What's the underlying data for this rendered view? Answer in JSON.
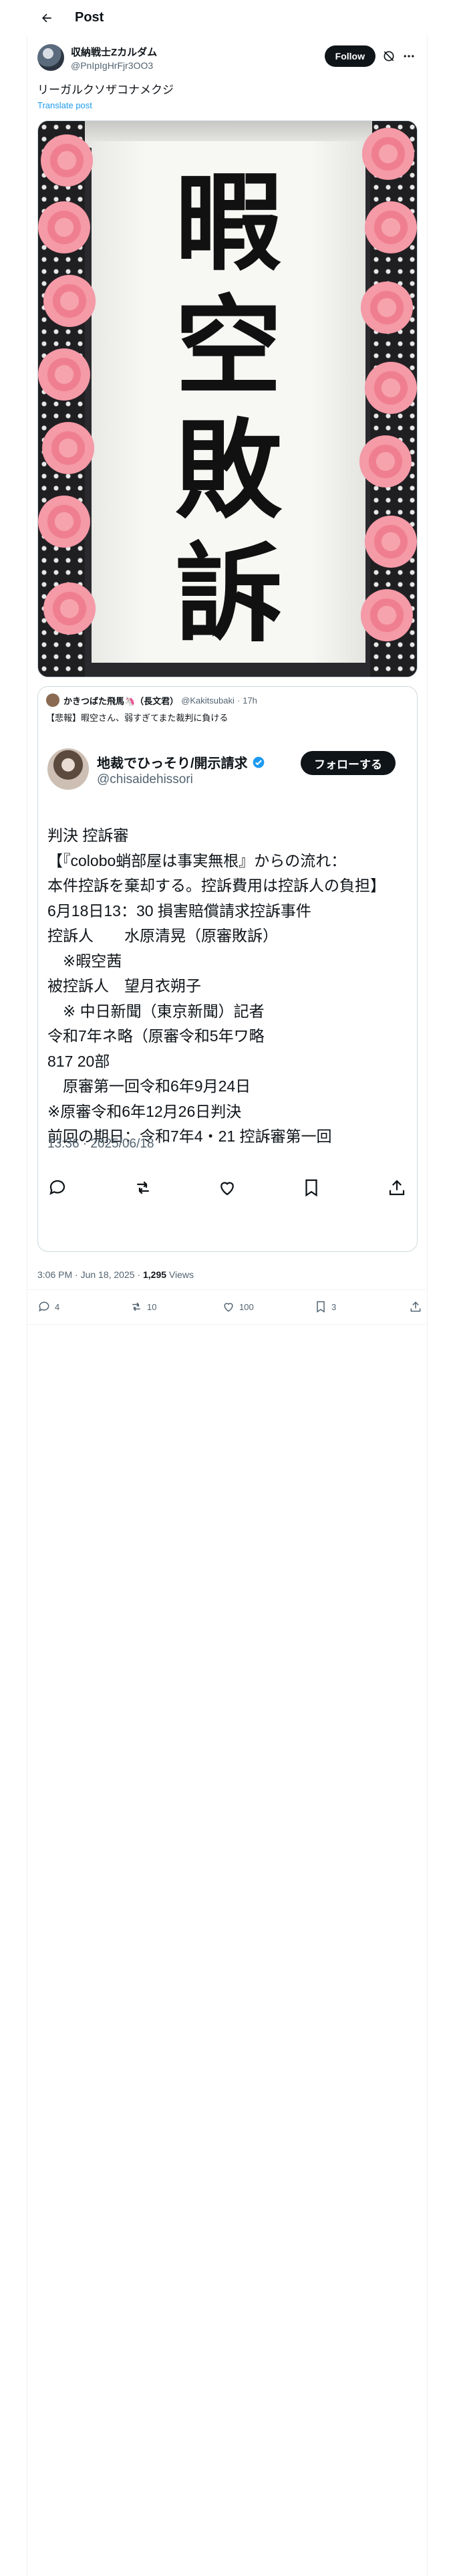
{
  "header": {
    "title": "Post"
  },
  "author": {
    "display_name": "収納戦士Zカルダム",
    "handle": "@PnIpIgHrFjr3OO3",
    "follow_label": "Follow"
  },
  "tweet": {
    "text": "リーガルクソザコナメクジ",
    "translate_label": "Translate post"
  },
  "media": {
    "calligraphy": [
      "暇",
      "空",
      "敗",
      "訴"
    ]
  },
  "quote": {
    "name": "かきつばた飛馬🦄（長文君）",
    "handle": "@Kakitsubaki",
    "time": "17h",
    "text": "【悲報】暇空さん、弱すぎてまた裁判に負ける",
    "inner": {
      "name": "地裁でひっそり/開示請求",
      "handle": "@chisaidehissori",
      "follow_label": "フォローする",
      "body": "判決 控訴審\n【『colobo蛸部屋は事実無根』からの流れ：\n本件控訴を棄却する。控訴費用は控訴人の負担】\n6月18日13：30 損害賠償請求控訴事件\n控訴人　　水原清晃（原審敗訴）\n　※暇空茜\n被控訴人　望月衣朔子\n　※ 中日新聞（東京新聞）記者\n令和7年ネ略（原審令和5年ワ略\n817 20部\n　原審第一回令和6年9月24日\n※原審令和6年12月26日判決\n前回の期日：令和7年4・21 控訴審第一回",
      "timestamp": "13:36 · 2025/06/18"
    }
  },
  "meta": {
    "time": "3:06 PM · Jun 18, 2025 · ",
    "views_count": "1,295",
    "views_label": " Views"
  },
  "actions": {
    "replies": "4",
    "reposts": "10",
    "likes": "100",
    "bookmarks": "3"
  }
}
